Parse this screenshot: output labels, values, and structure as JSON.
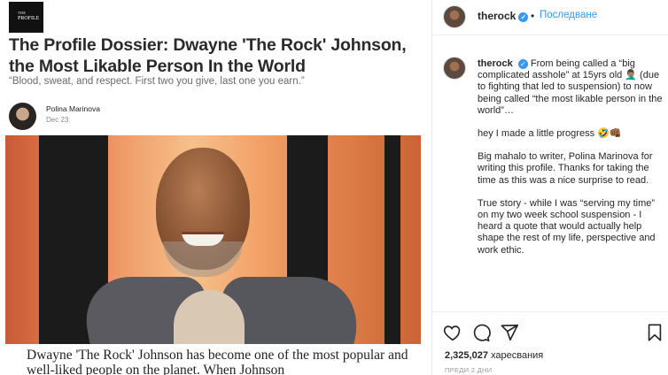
{
  "article": {
    "logo_line1": "THE",
    "logo_line2": "PROFILE",
    "title": "The Profile Dossier: Dwayne 'The Rock' Johnson, the Most Likable Person In the World",
    "subtitle": "“Blood, sweat, and respect. First two you give, last one you earn.”",
    "author": "Polina Marinova",
    "date": "Dec 23",
    "body_start": "Dwayne 'The Rock' Johnson has become one of the most popular and well-liked people on the planet. When Johnson"
  },
  "instagram": {
    "username": "therock",
    "separator": "•",
    "follow_label": "Последване",
    "caption": {
      "username": "therock",
      "p1": "From being called a “big complicated asshole” at 15yrs old 🤦🏽‍♂️ (due to fighting that led to suspension) to now being called “the most likable person in the world”…",
      "p2": "hey I made a little progress 🤣👊🏾",
      "p3": "Big mahalo to writer, Polina Marinova for writing this profile. Thanks for taking the time as this was a nice surprise to read.",
      "p4": "True story - while I was “serving my time” on my two week school suspension - I heard a quote that would actually help shape the rest of my life, perspective and work ethic."
    },
    "likes_count": "2,325,027",
    "likes_label": "харесвания",
    "time_ago": "ПРЕДИ 2 ДНИ",
    "icons": [
      "heart-icon",
      "comment-icon",
      "share-icon",
      "bookmark-icon"
    ]
  },
  "colors": {
    "link_blue": "#3897f0",
    "verified_blue": "#3897f0"
  }
}
